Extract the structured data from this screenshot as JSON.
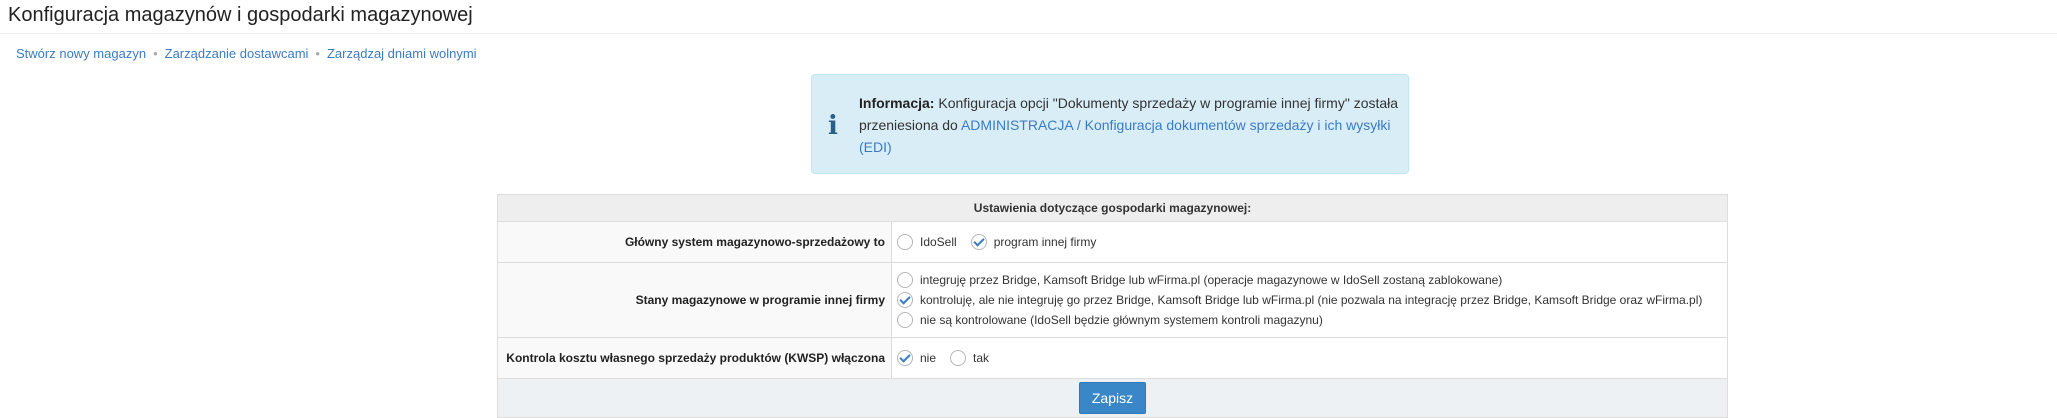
{
  "page": {
    "title": "Konfiguracja magazynów i gospodarki magazynowej"
  },
  "breadcrumb": {
    "items": [
      "Stwórz nowy magazyn",
      "Zarządzanie dostawcami",
      "Zarządzaj dniami wolnymi"
    ],
    "separator": "•"
  },
  "info": {
    "icon": "info-icon",
    "label": "Informacja:",
    "text": " Konfiguracja opcji \"Dokumenty sprzedaży w programie innej firmy\" została przeniesiona do ",
    "link": "ADMINISTRACJA / Konfiguracja dokumentów sprzedaży i ich wysyłki (EDI)"
  },
  "settings": {
    "heading": "Ustawienia dotyczące gospodarki magazynowej:",
    "rows": [
      {
        "label": "Główny system magazynowo-sprzedażowy to",
        "options": [
          {
            "label": "IdoSell",
            "checked": false
          },
          {
            "label": "program innej firmy",
            "checked": true
          }
        ]
      },
      {
        "label": "Stany magazynowe w programie innej firmy",
        "options": [
          {
            "label": "integruję przez Bridge, Kamsoft Bridge lub wFirma.pl (operacje magazynowe w IdoSell zostaną zablokowane)",
            "checked": false
          },
          {
            "label": "kontroluję, ale nie integruję go przez Bridge, Kamsoft Bridge lub wFirma.pl (nie pozwala na integrację przez Bridge, Kamsoft Bridge oraz wFirma.pl)",
            "checked": true
          },
          {
            "label": "nie są kontrolowane (IdoSell będzie głównym systemem kontroli magazynu)",
            "checked": false
          }
        ]
      },
      {
        "label": "Kontrola kosztu własnego sprzedaży produktów (KWSP) włączona",
        "options": [
          {
            "label": "nie",
            "checked": true
          },
          {
            "label": "tak",
            "checked": false
          }
        ]
      }
    ],
    "save_label": "Zapisz"
  },
  "colors": {
    "link": "#3a7cc4",
    "info_bg": "#d9edf7",
    "info_border": "#bce8f1",
    "button": "#3a87c8"
  }
}
